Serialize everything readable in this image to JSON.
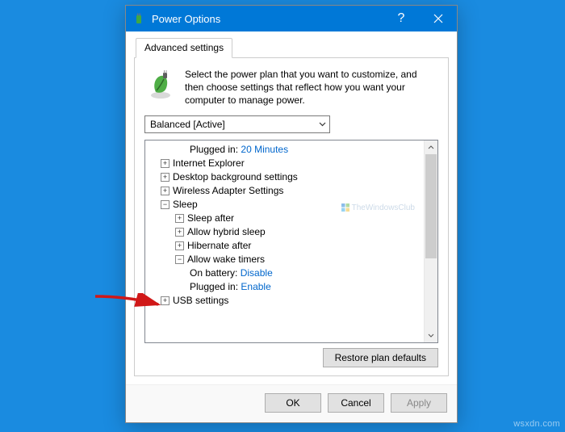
{
  "window": {
    "title": "Power Options"
  },
  "tab": {
    "advanced": "Advanced settings"
  },
  "intro": "Select the power plan that you want to customize, and then choose settings that reflect how you want your computer to manage power.",
  "dropdown": {
    "selected": "Balanced [Active]"
  },
  "tree": {
    "plugged_in_top_label": "Plugged in:",
    "plugged_in_top_value": "20 Minutes",
    "ie": "Internet Explorer",
    "desktop_bg": "Desktop background settings",
    "wireless": "Wireless Adapter Settings",
    "sleep": "Sleep",
    "sleep_after": "Sleep after",
    "allow_hybrid": "Allow hybrid sleep",
    "hibernate_after": "Hibernate after",
    "allow_wake": "Allow wake timers",
    "on_battery_label": "On battery:",
    "on_battery_value": "Disable",
    "plugged_in_label": "Plugged in:",
    "plugged_in_value": "Enable",
    "usb": "USB settings"
  },
  "watermark": "TheWindowsClub",
  "restore_button": "Restore plan defaults",
  "buttons": {
    "ok": "OK",
    "cancel": "Cancel",
    "apply": "Apply"
  },
  "credit": "wsxdn.com"
}
